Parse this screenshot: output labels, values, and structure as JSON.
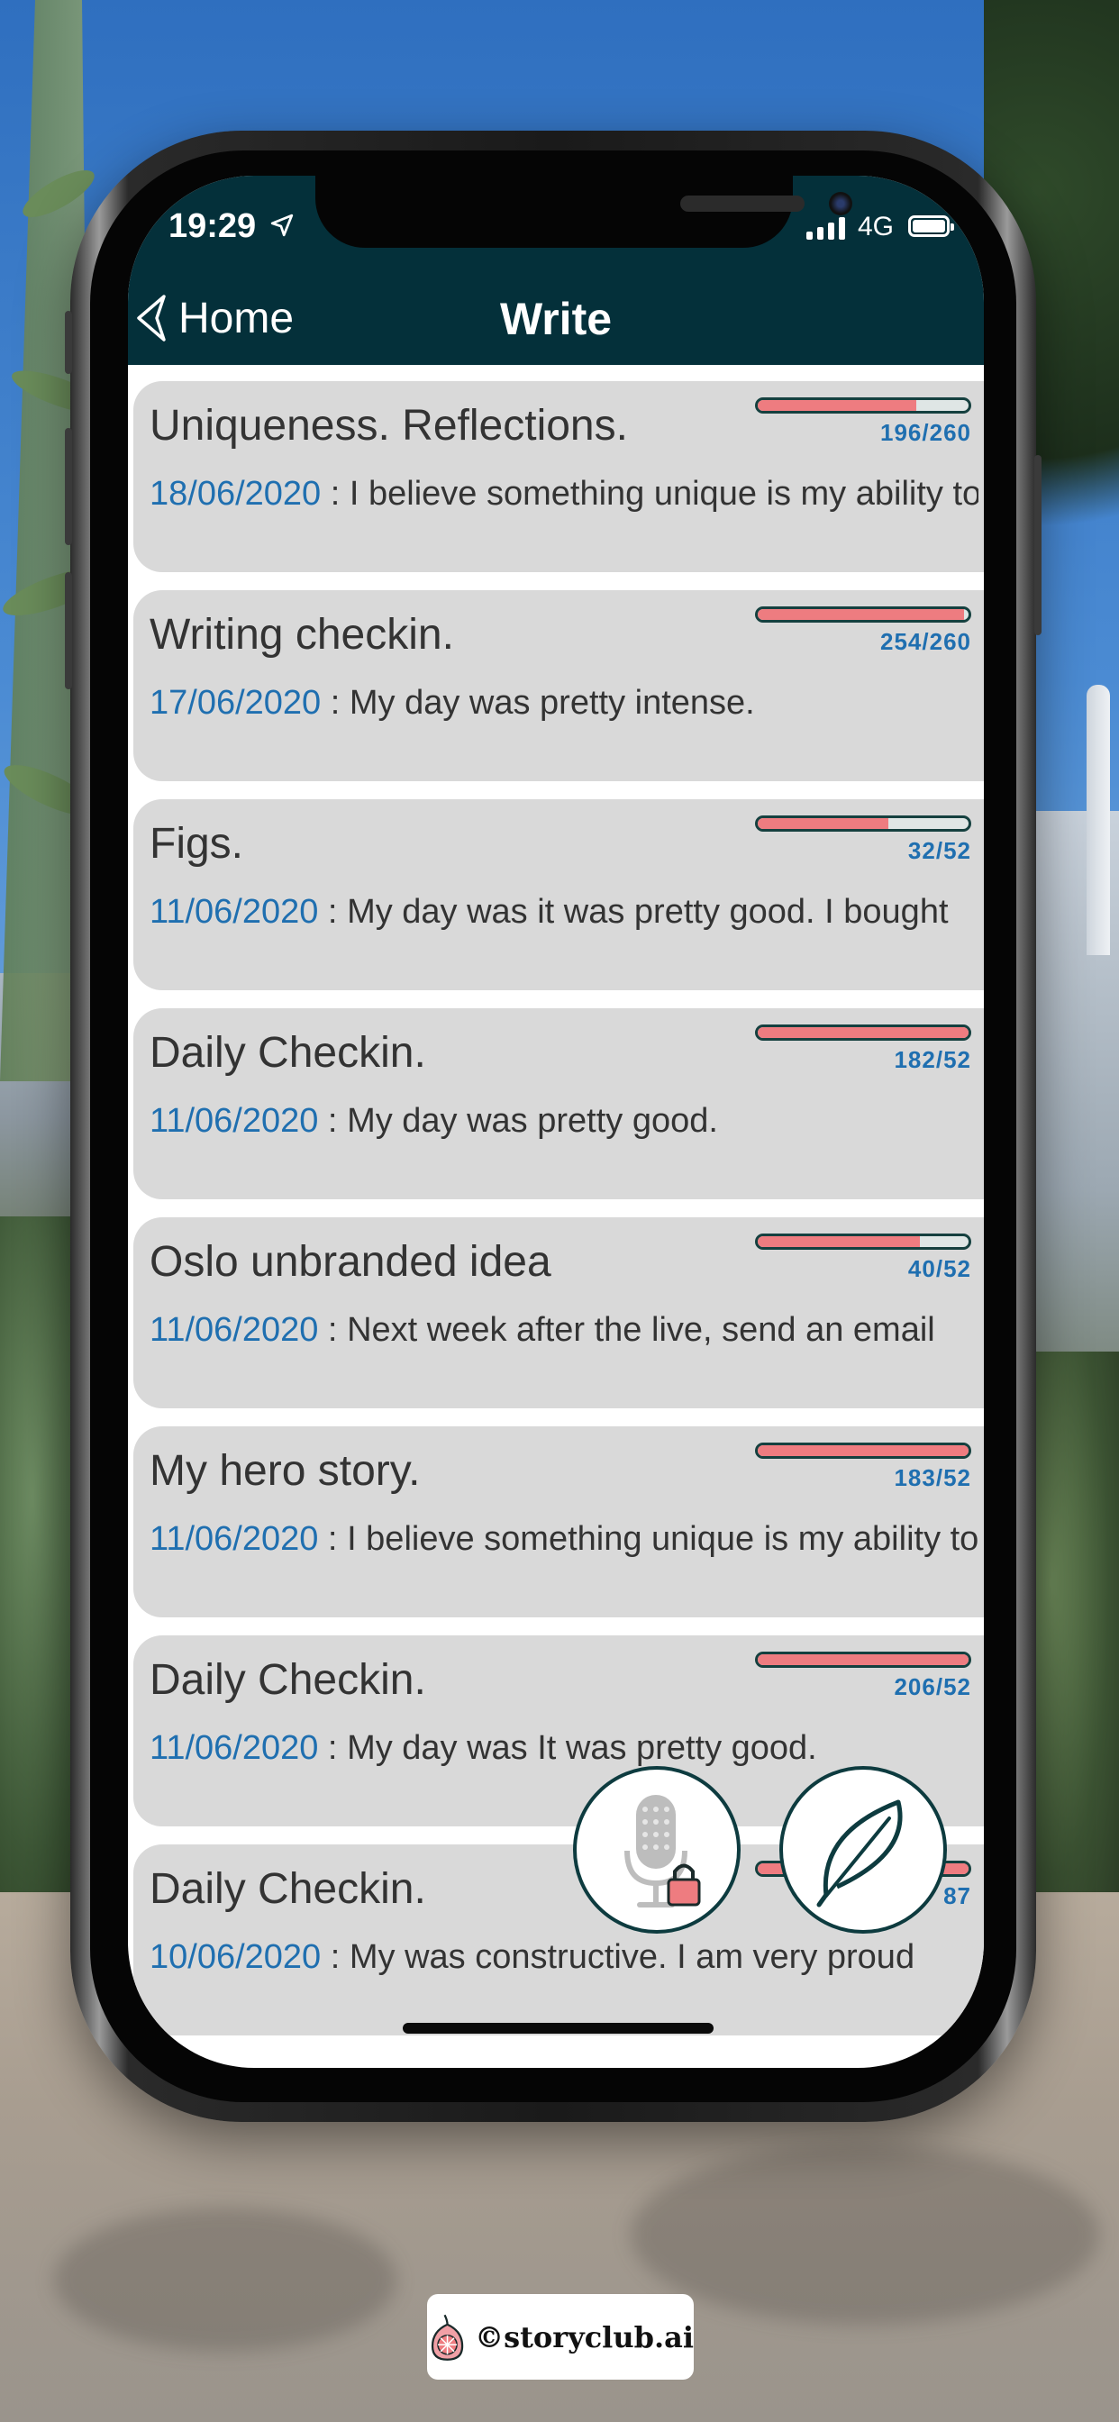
{
  "status_bar": {
    "time": "19:29",
    "network": "4G"
  },
  "nav": {
    "back_label": "Home",
    "title": "Write"
  },
  "entries": [
    {
      "title": "Uniqueness. Reflections.",
      "date": "18/06/2020",
      "separator": " : ",
      "excerpt": "I believe something unique is my ability to",
      "progress_label": "196/260",
      "progress": 0.75
    },
    {
      "title": "Writing checkin.",
      "date": "17/06/2020",
      "separator": " : ",
      "excerpt": "My day was pretty intense.",
      "progress_label": "254/260",
      "progress": 0.98
    },
    {
      "title": "Figs.",
      "date": "11/06/2020",
      "separator": " : ",
      "excerpt": "My day was it was pretty good. I bought",
      "progress_label": "32/52",
      "progress": 0.62
    },
    {
      "title": "Daily Checkin.",
      "date": "11/06/2020",
      "separator": " : ",
      "excerpt": "My day was pretty good.",
      "progress_label": "182/52",
      "progress": 1.0
    },
    {
      "title": "Oslo unbranded idea",
      "date": "11/06/2020",
      "separator": " : ",
      "excerpt": "Next week after the live, send an email",
      "progress_label": "40/52",
      "progress": 0.77
    },
    {
      "title": "My hero story.",
      "date": "11/06/2020",
      "separator": " : ",
      "excerpt": "I believe something unique is my ability to",
      "progress_label": "183/52",
      "progress": 1.0
    },
    {
      "title": "Daily Checkin.",
      "date": "11/06/2020",
      "separator": " : ",
      "excerpt": "My day was It was pretty good.",
      "progress_label": "206/52",
      "progress": 1.0
    },
    {
      "title": "Daily Checkin.",
      "date": "10/06/2020",
      "separator": " : ",
      "excerpt": "My was constructive. I am very proud",
      "progress_label": "87",
      "progress": 1.0
    }
  ],
  "icons": {
    "voice": "microphone-lock-icon",
    "write": "feather-icon",
    "back": "back-arrow-icon",
    "brand": "fig-logo-icon"
  },
  "colors": {
    "header": "#04303a",
    "card": "#d9d9d9",
    "date": "#1f6fb0",
    "progress_fill": "#ee7c80",
    "progress_border": "#15403f"
  },
  "watermark": {
    "text": "©storyclub.ai"
  }
}
